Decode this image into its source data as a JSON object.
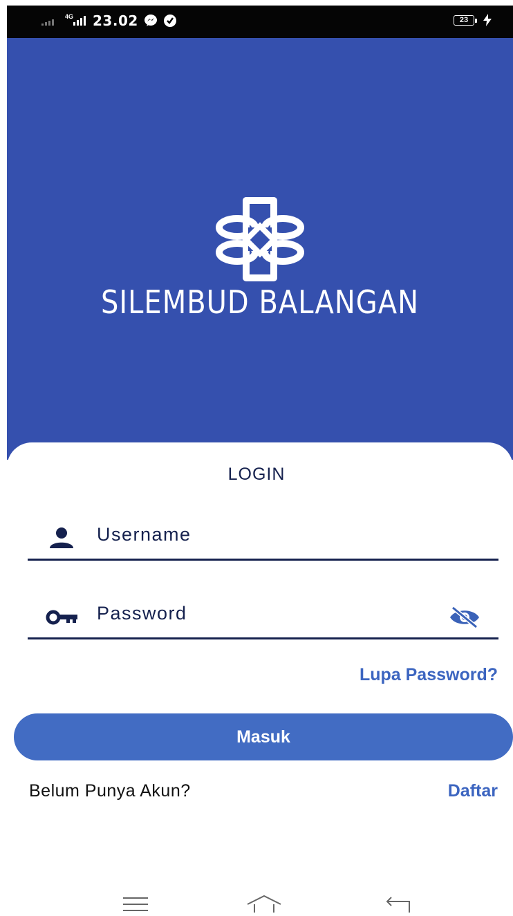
{
  "status_bar": {
    "time": "23.02",
    "network": "4G",
    "battery_level": "23"
  },
  "brand": {
    "app_name": "SILEMBUD BALANGAN",
    "hero_color": "#3550ae"
  },
  "login": {
    "title": "LOGIN",
    "username_placeholder": "Username",
    "password_placeholder": "Password",
    "forgot_password_link": "Lupa Password?",
    "submit_label": "Masuk",
    "no_account_text": "Belum Punya Akun?",
    "register_link": "Daftar"
  },
  "colors": {
    "primary": "#426cc3",
    "link": "#3c65c0",
    "text_dark": "#15214e"
  },
  "icons": {
    "user": "user-icon",
    "key": "key-icon",
    "visibility": "eye-off-icon",
    "nav_menu": "menu-icon",
    "nav_home": "home-icon",
    "nav_back": "back-icon"
  }
}
